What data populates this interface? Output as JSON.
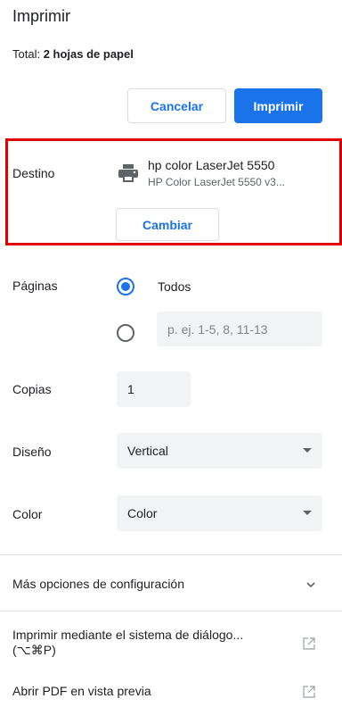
{
  "header": {
    "title": "Imprimir",
    "total_prefix": "Total: ",
    "total_value": "2 hojas de papel"
  },
  "actions": {
    "cancel_label": "Cancelar",
    "print_label": "Imprimir"
  },
  "destination": {
    "label": "Destino",
    "printer_name": "hp color LaserJet 5550",
    "printer_detail": "HP Color LaserJet 5550 v3...",
    "change_label": "Cambiar",
    "icon": "printer-icon"
  },
  "pages": {
    "label": "Páginas",
    "option_all": "Todos",
    "custom_placeholder": "p. ej. 1-5, 8, 11-13",
    "selected": "all"
  },
  "copies": {
    "label": "Copias",
    "value": "1"
  },
  "layout": {
    "label": "Diseño",
    "value": "Vertical"
  },
  "color": {
    "label": "Color",
    "value": "Color"
  },
  "more_settings": {
    "label": "Más opciones de configuración",
    "icon": "chevron-down-icon"
  },
  "links": {
    "system_dialog_line1": "Imprimir mediante el sistema de diálogo...",
    "system_dialog_line2": "(⌥⌘P)",
    "open_pdf": "Abrir PDF en vista previa",
    "icon": "open-external-icon"
  },
  "colors": {
    "accent": "#1a73e8",
    "highlight_border": "#e00000"
  }
}
